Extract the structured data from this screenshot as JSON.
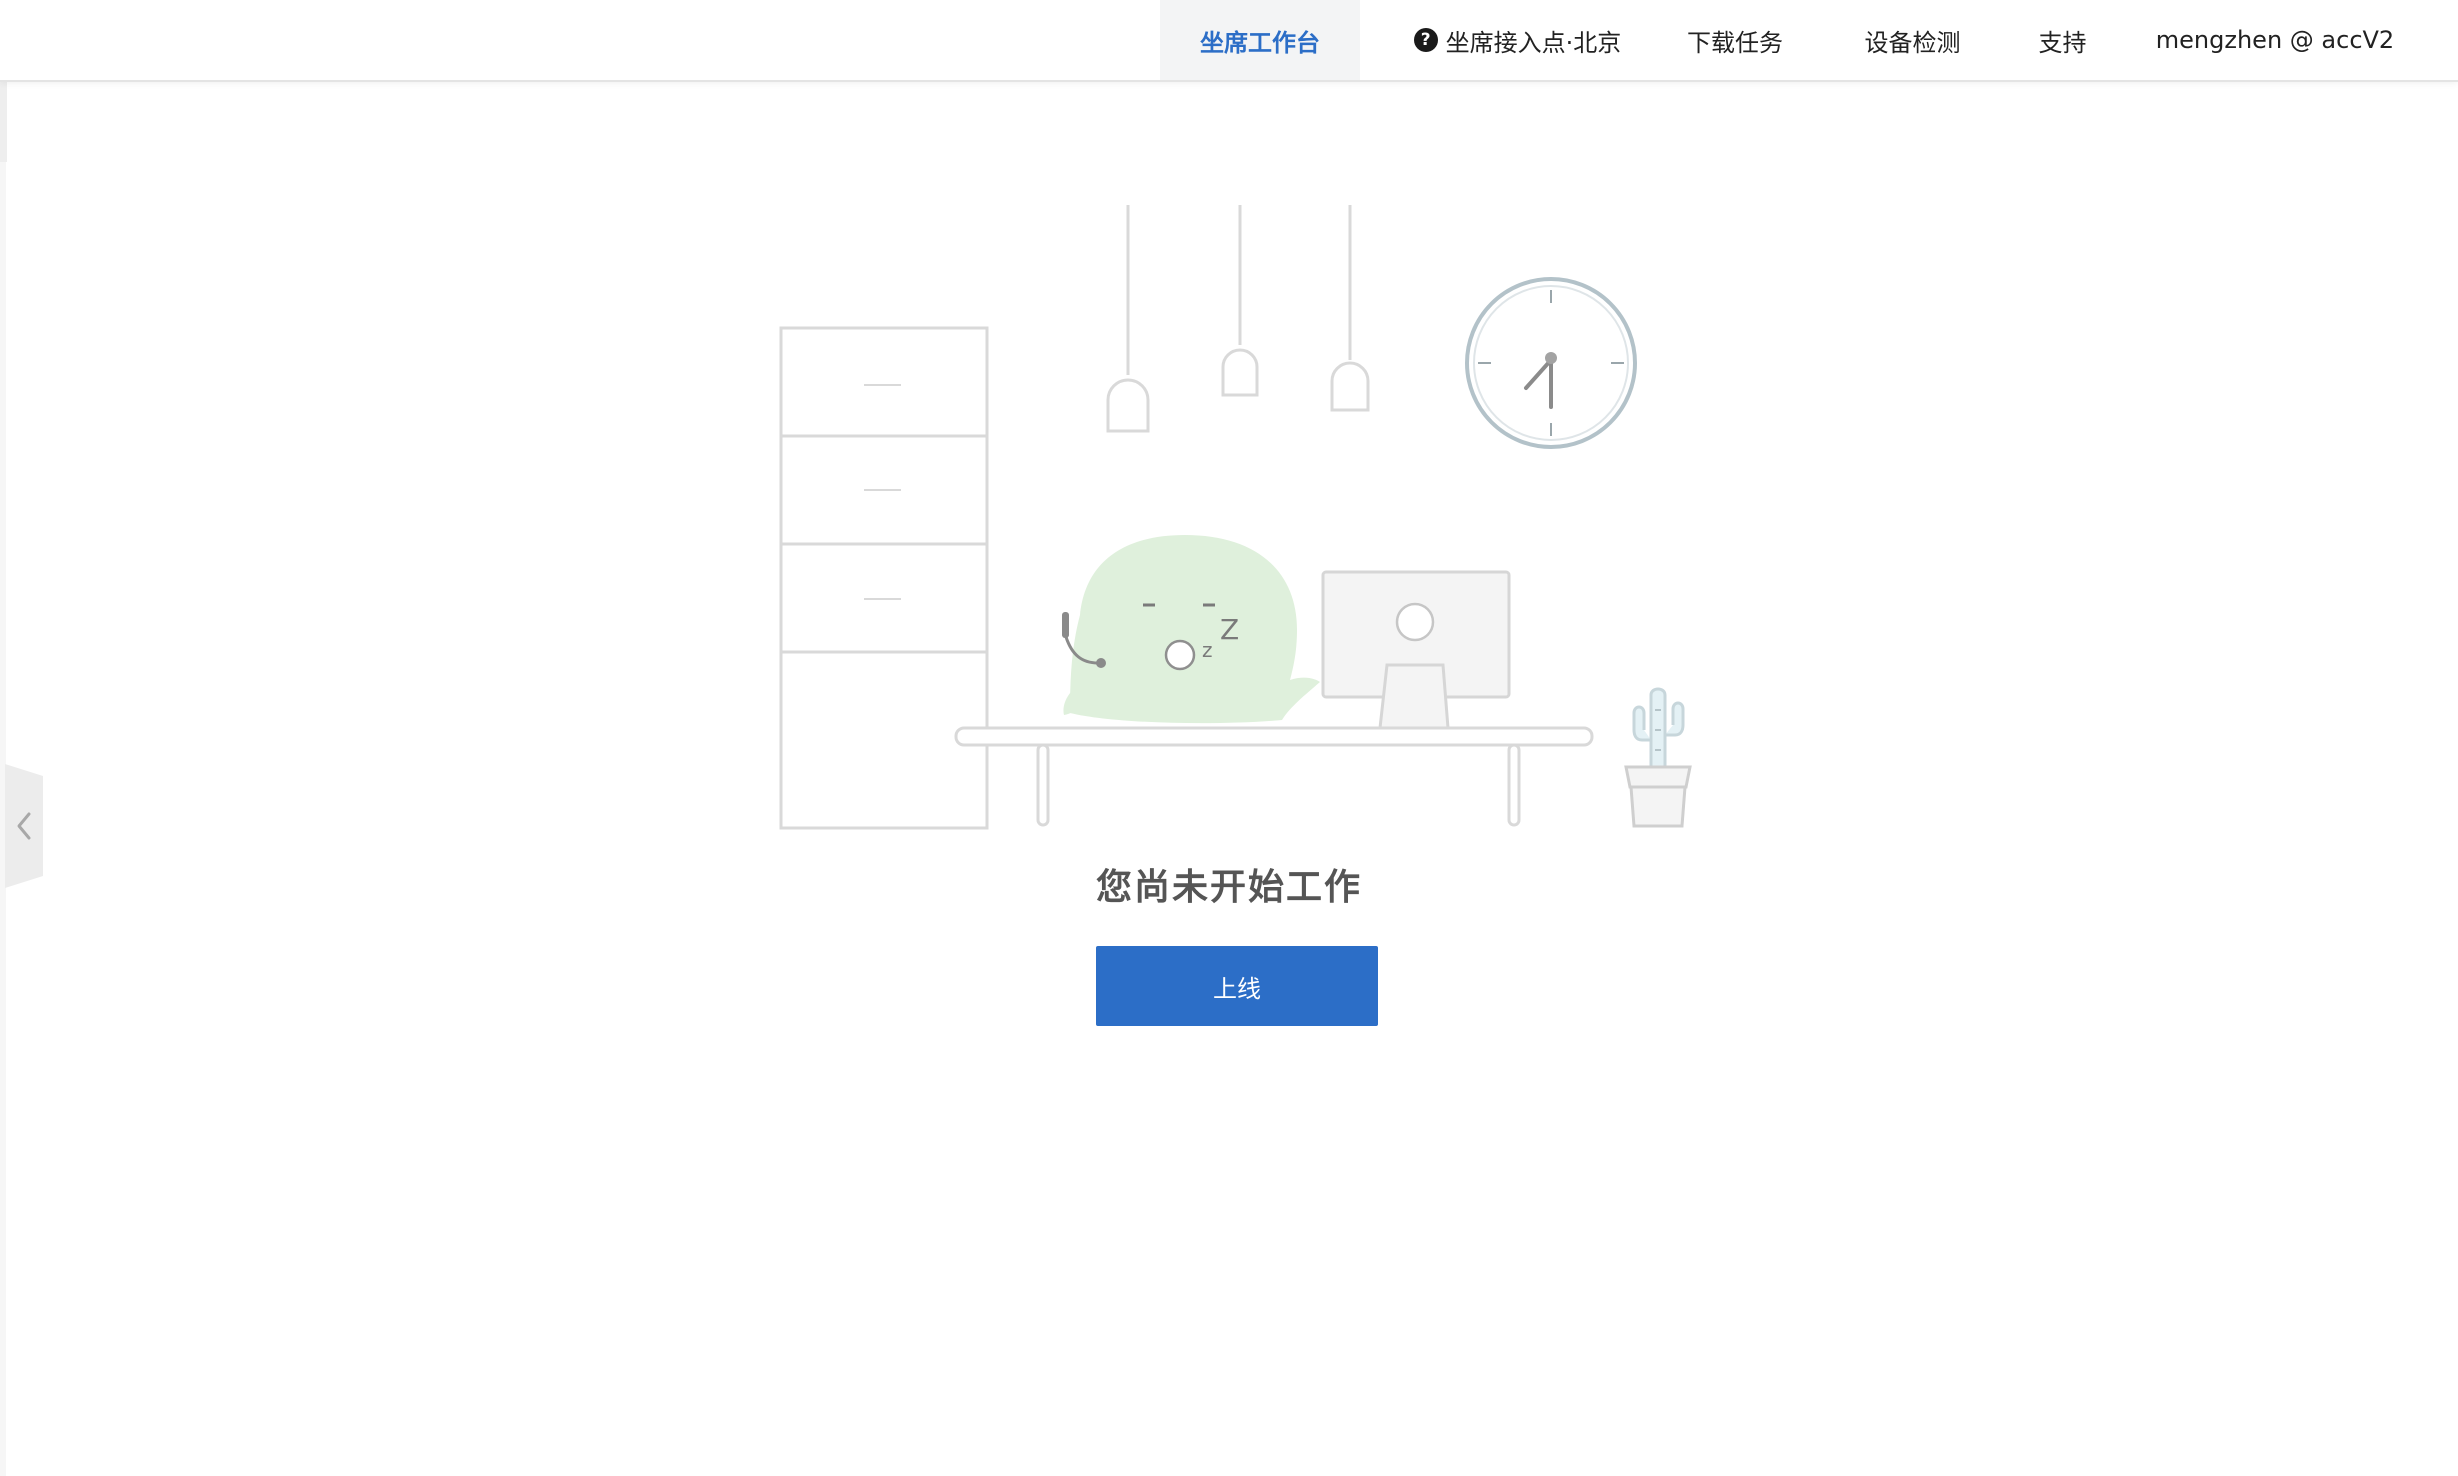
{
  "nav": {
    "workbench": "坐席工作台",
    "access_point": "坐席接入点·北京",
    "download_tasks": "下载任务",
    "device_check": "设备检测",
    "support": "支持",
    "user": "mengzhen @ accV2"
  },
  "main": {
    "empty_message": "您尚未开始工作",
    "online_button": "上线"
  },
  "icons": {
    "help": "question-circle-icon",
    "collapse": "chevron-left-icon"
  },
  "colors": {
    "accent": "#2c6ec7",
    "active_tab_bg": "#f3f4f5",
    "mascot": "#dff0dc"
  }
}
